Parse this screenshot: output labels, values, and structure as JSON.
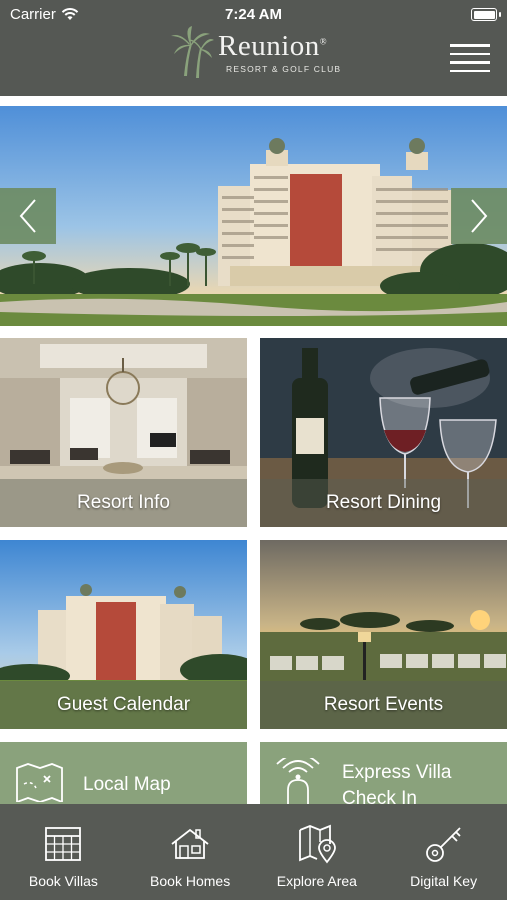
{
  "status_bar": {
    "carrier": "Carrier",
    "time": "7:24 AM",
    "wifi_icon": "wifi-icon",
    "battery_icon": "battery-icon"
  },
  "header": {
    "brand_name": "Reunion",
    "brand_mark": "®",
    "brand_subtitle": "RESORT & GOLF CLUB",
    "logo_icon": "palm-trees-icon",
    "menu_icon": "hamburger-menu-icon",
    "background": "#555854"
  },
  "hero": {
    "image": "resort-tower-hotel-photo",
    "prev_icon": "chevron-left-icon",
    "next_icon": "chevron-right-icon",
    "arrow_color": "#6e8c64"
  },
  "tiles": [
    {
      "label": "Resort Info",
      "image": "grand-lobby-photo"
    },
    {
      "label": "Resort Dining",
      "image": "wine-pouring-photo"
    },
    {
      "label": "Guest Calendar",
      "image": "resort-tower-photo"
    },
    {
      "label": "Resort Events",
      "image": "golf-carts-sunset-photo"
    }
  ],
  "green_tiles": [
    {
      "label": "Local Map",
      "icon": "treasure-map-icon"
    },
    {
      "label_line1": "Express Villa",
      "label_line2": "Check In",
      "icon": "bell-signal-icon"
    }
  ],
  "bottom_nav": [
    {
      "label": "Book Villas",
      "icon": "calendar-grid-icon"
    },
    {
      "label": "Book Homes",
      "icon": "house-icon"
    },
    {
      "label": "Explore Area",
      "icon": "map-pin-icon"
    },
    {
      "label": "Digital Key",
      "icon": "key-icon"
    }
  ],
  "colors": {
    "accent_green": "#8aa27c",
    "nav_background": "#575a55"
  }
}
